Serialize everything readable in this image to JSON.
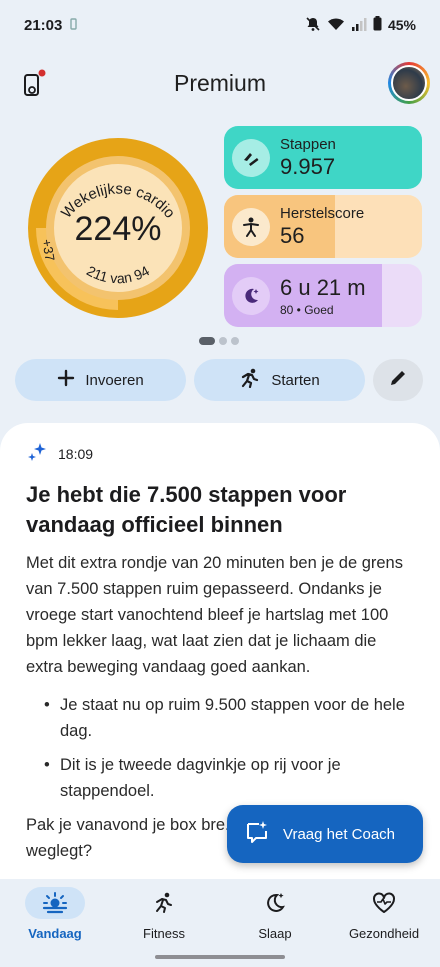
{
  "status_bar": {
    "time": "21:03",
    "battery": "45%"
  },
  "app_bar": {
    "title": "Premium"
  },
  "cardio": {
    "label": "Wekelijkse cardio",
    "percent": "224%",
    "progress_text": "211 van 94",
    "extra": "+37",
    "progress_fraction": 2.24
  },
  "tiles": [
    {
      "label": "Stappen",
      "value": "9.957",
      "sub": "",
      "icon": "steps-icon",
      "fill_fraction": 1.0,
      "bg": "#c9f1ec",
      "fill": "#3fd6c6"
    },
    {
      "label": "Herstelscore",
      "value": "56",
      "sub": "",
      "icon": "recovery-icon",
      "fill_fraction": 0.56,
      "bg": "#fde0b8",
      "fill": "#f8c57e"
    },
    {
      "label": "",
      "value": "6 u 21 m",
      "sub": "80 • Goed",
      "icon": "moon-icon",
      "fill_fraction": 0.8,
      "bg": "#ebdcf8",
      "fill": "#d3b1f2"
    }
  ],
  "actions": {
    "add_label": "Invoeren",
    "start_label": "Starten"
  },
  "insight": {
    "time": "18:09",
    "title": "Je hebt die 7.500 stappen voor vandaag officieel binnen",
    "body": "Met dit extra rondje van 20 minuten ben je de grens van 7.500 stappen ruim gepasseerd. Ondanks je vroege start vanochtend bleef je hartslag met 100 bpm lekker laag, wat laat zien dat je lichaam die extra beweging vandaag goed aankan.",
    "bullets": [
      "Je staat nu op ruim 9.500 stappen voor de hele dag.",
      "Dit is je tweede dagvinkje op rij voor je stappendoel."
    ],
    "closing": "Pak je vanavond je box bre... voordat je je telefoon weglegt?"
  },
  "coach_button": {
    "label": "Vraag het Coach"
  },
  "nav": [
    {
      "label": "Vandaag",
      "icon": "sun-horizon-icon",
      "active": true
    },
    {
      "label": "Fitness",
      "icon": "running-icon",
      "active": false
    },
    {
      "label": "Slaap",
      "icon": "moon-star-icon",
      "active": false
    },
    {
      "label": "Gezondheid",
      "icon": "heart-pulse-icon",
      "active": false
    }
  ],
  "colors": {
    "accent": "#1565c0",
    "cardio_ring": "#e6a417",
    "cardio_inner": "#fbe3b8"
  }
}
